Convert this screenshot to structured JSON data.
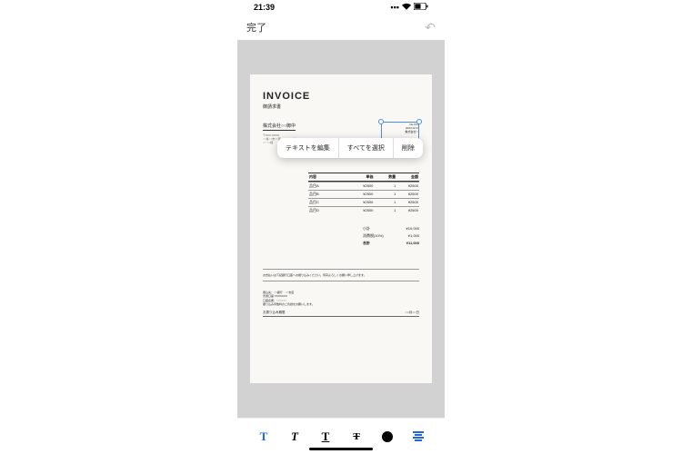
{
  "status": {
    "time": "21:39",
    "signal": "▪▪▪▪",
    "wifi": "◈",
    "battery": "▮"
  },
  "nav": {
    "done": "完了"
  },
  "doc": {
    "title": "INVOICE",
    "subtitle": "御請求書",
    "client": "株式会社○○御中",
    "addr1": "〒XXX-XXXX",
    "addr2": "○○県○○市○○区○○x-x-x○○ビル1F",
    "addr3": "○○ ○○様",
    "stamp_no": "No.XXX",
    "stamp_date": "2023.12.31",
    "stamp_corp": "株式会社○○",
    "columns": {
      "name": "内容",
      "price": "単価",
      "qty": "数量",
      "amount": "金額"
    },
    "items": [
      {
        "name": "品目A",
        "price": "¥2500",
        "qty": "1",
        "amount": "¥2500"
      },
      {
        "name": "品目B",
        "price": "¥2500",
        "qty": "1",
        "amount": "¥2500"
      },
      {
        "name": "品目C",
        "price": "¥2500",
        "qty": "1",
        "amount": "¥2500"
      },
      {
        "name": "品目D",
        "price": "¥2500",
        "qty": "1",
        "amount": "¥2500"
      }
    ],
    "totals": {
      "subtotal_label": "小計",
      "subtotal": "¥10,000",
      "tax_label": "消費税(10%)",
      "tax": "¥1,000",
      "total_label": "合計",
      "total": "¥11,000"
    },
    "note": "お支払いは下記銀行口座へお振り込みください。何卒よろしくお願い申し上げます。",
    "bank1": "振込先：○○銀行　○○支店",
    "bank2": "普通口座 XXXXXXX",
    "bank3": "口座名義：○○○○○○",
    "bank4": "振り込み手数料のご負担をお願いします。",
    "deadline_label": "お振り込み期限",
    "deadline_value": "○○月○○日"
  },
  "context_menu": {
    "edit": "テキストを編集",
    "select_all": "すべてを選択",
    "delete": "削除"
  },
  "tools": {
    "t": "T"
  }
}
